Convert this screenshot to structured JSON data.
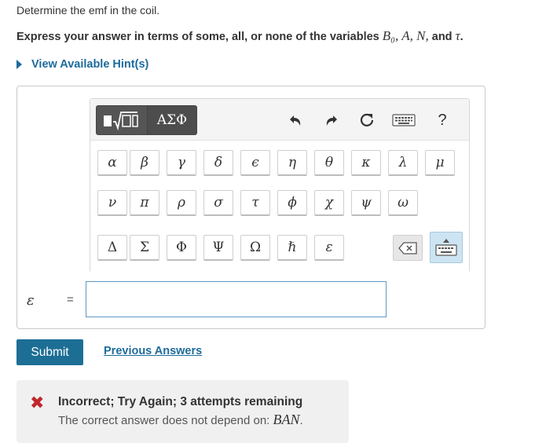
{
  "question": {
    "prompt": "Determine the emf in the coil.",
    "express_text": "Express your answer in terms of some, all, or none of the variables ",
    "variables_text": "B₀, A, N,",
    "and_text": " and ",
    "tau_text": "τ",
    "period": "."
  },
  "hint": {
    "label": "View Available Hint(s)"
  },
  "keyboard": {
    "greek_toggle_label": "ΑΣΦ",
    "help_label": "?",
    "rows": [
      [
        "α",
        "β",
        "γ",
        "δ",
        "ϵ",
        "η",
        "θ",
        "κ",
        "λ",
        "μ"
      ],
      [
        "ν",
        "π",
        "ρ",
        "σ",
        "τ",
        "ϕ",
        "χ",
        "ψ",
        "ω"
      ],
      [
        "Δ",
        "Σ",
        "Φ",
        "Ψ",
        "Ω",
        "ℏ",
        "ε"
      ]
    ],
    "icons": [
      "template-icon",
      "undo-icon",
      "redo-icon",
      "reset-icon",
      "keyboard-shortcuts-icon",
      "help-icon",
      "backspace-icon",
      "keyboard-icon"
    ]
  },
  "answer": {
    "symbol": "ε",
    "equals": "=",
    "value": "",
    "placeholder": ""
  },
  "actions": {
    "submit_label": "Submit",
    "previous_answers_label": "Previous Answers"
  },
  "feedback": {
    "title": "Incorrect; Try Again; 3 attempts remaining",
    "detail_text": "The correct answer does not depend on: ",
    "detail_vars": "BAN",
    "detail_period": ".",
    "icon": "x-icon"
  },
  "colors": {
    "link": "#1d6b9b",
    "submit_bg": "#1d6e95",
    "error": "#c0272d",
    "input_border": "#5d97c4"
  }
}
